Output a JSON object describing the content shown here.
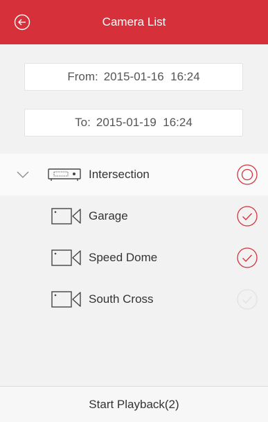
{
  "header": {
    "title": "Camera List",
    "back_icon": "back-circle-icon",
    "color": "#d6313b"
  },
  "date_range": {
    "from_label": "From:",
    "from_value": "2015-01-16  16:24",
    "to_label": "To:",
    "to_value": "2015-01-19  16:24"
  },
  "group": {
    "label": "Intersection",
    "expanded": true,
    "state": "partial"
  },
  "cameras": [
    {
      "label": "Garage",
      "checked": true
    },
    {
      "label": "Speed Dome",
      "checked": true
    },
    {
      "label": "South Cross",
      "checked": false
    }
  ],
  "footer": {
    "start_label": "Start Playback(2)"
  },
  "colors": {
    "accent": "#d6313b",
    "unchecked": "#dddddd"
  }
}
